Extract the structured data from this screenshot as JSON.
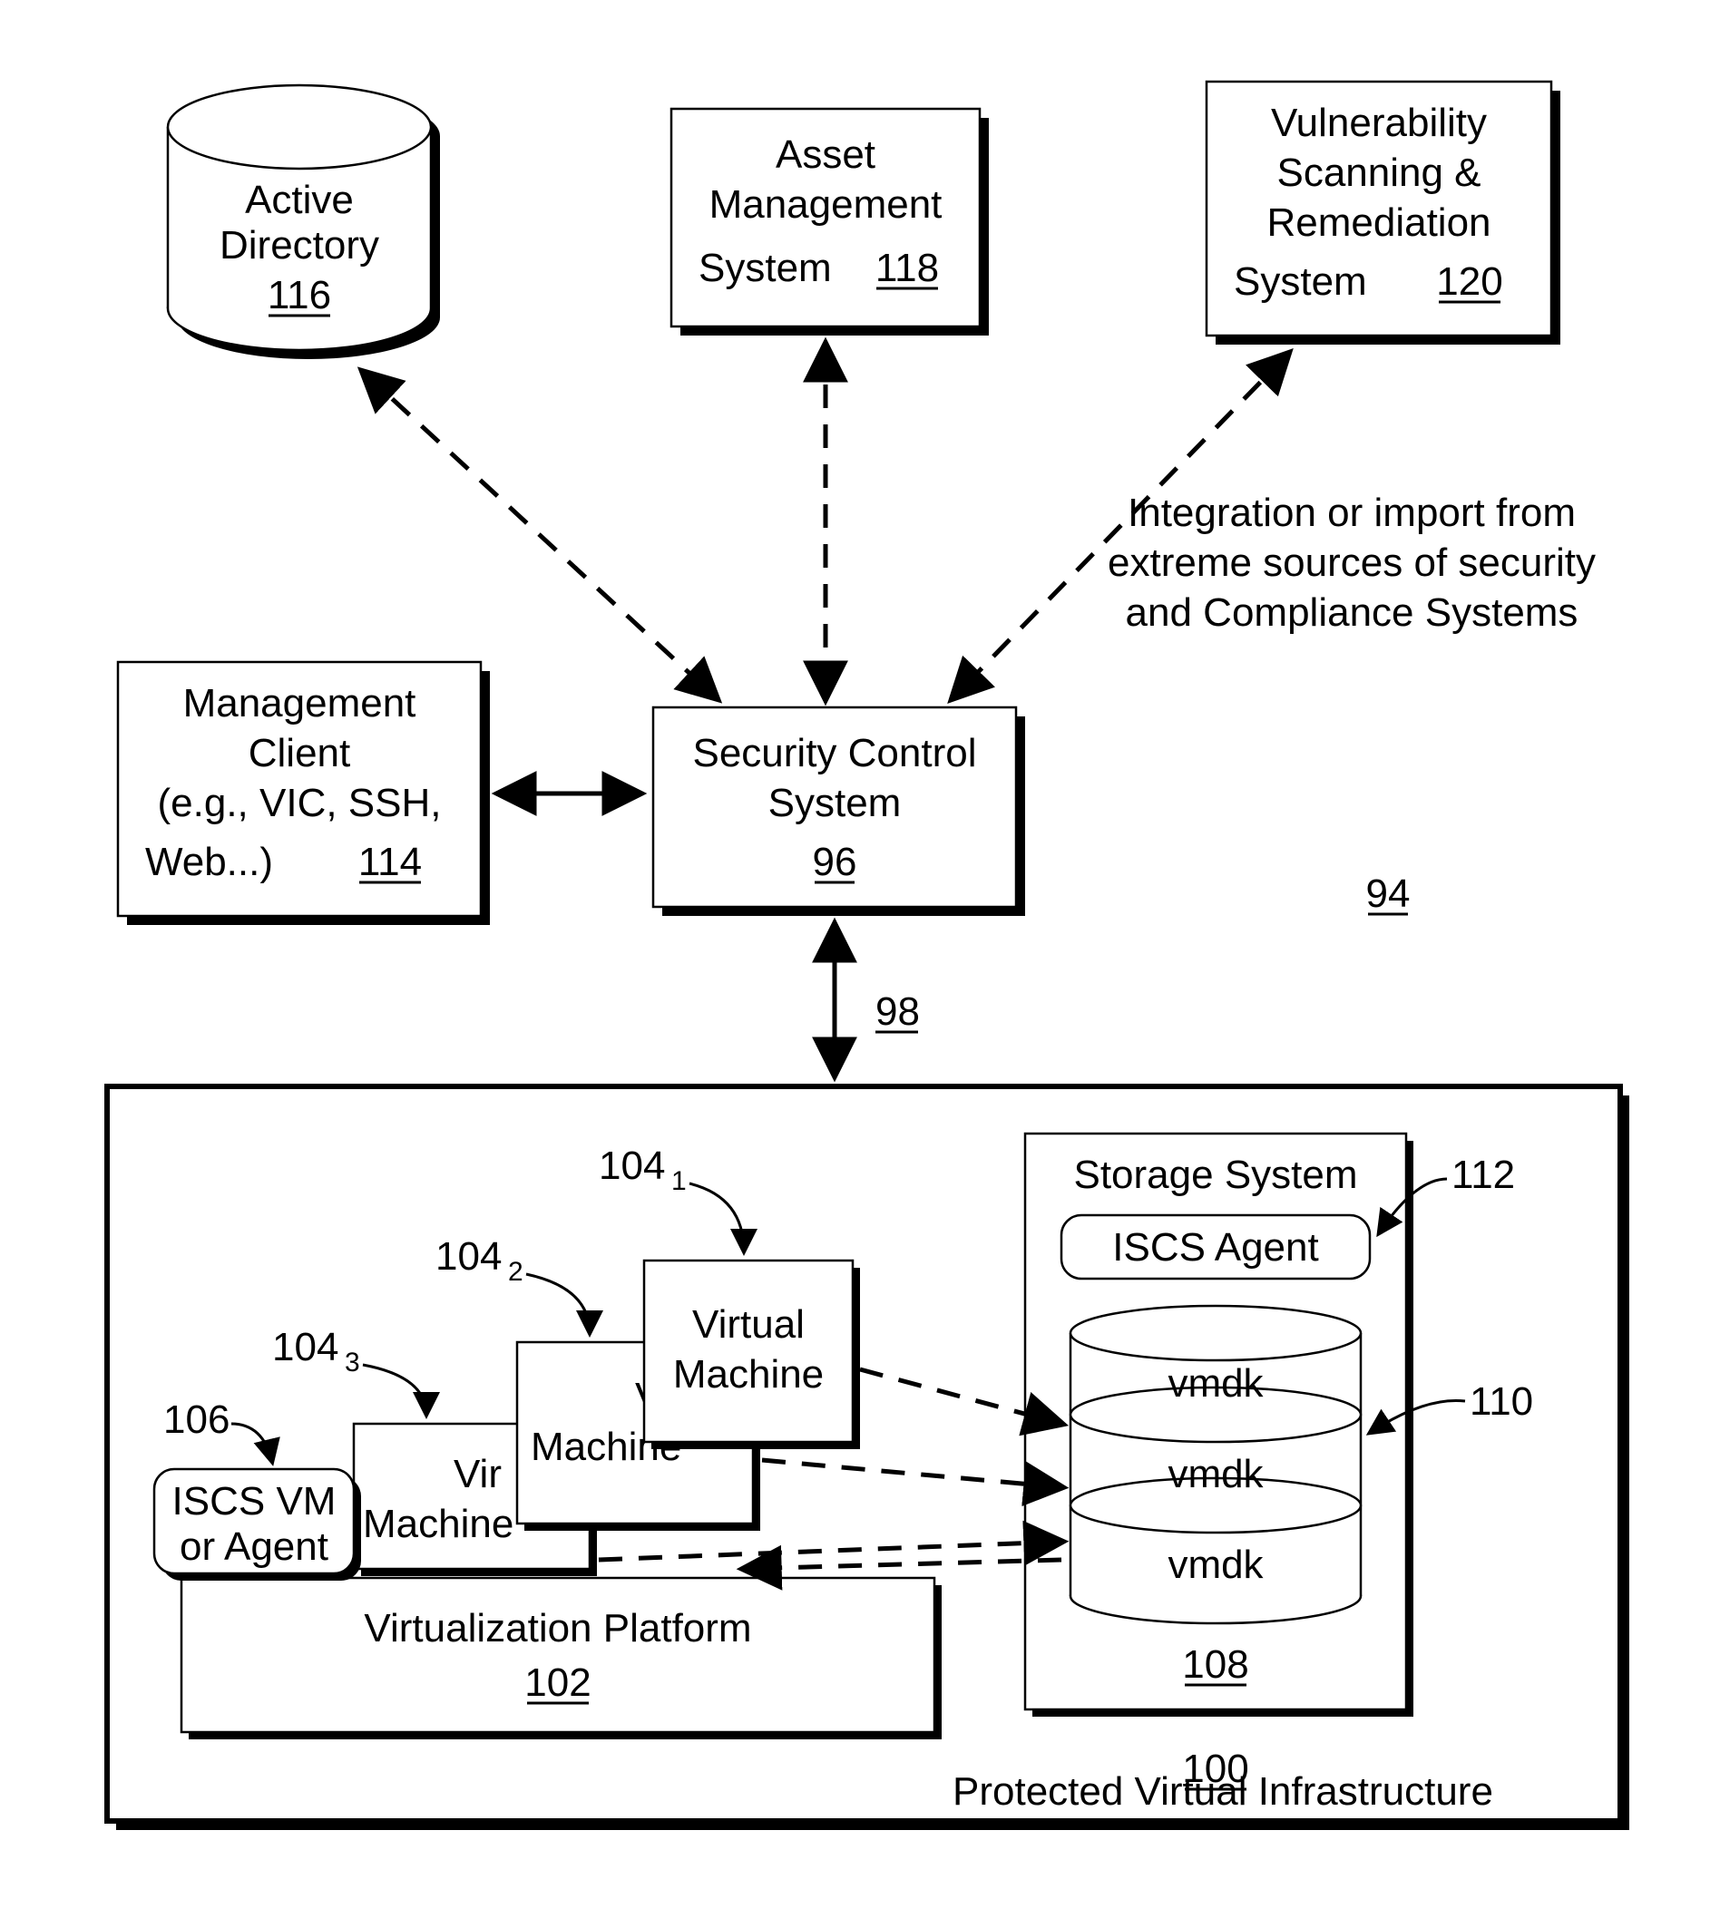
{
  "blocks": {
    "active_directory": {
      "label1": "Active",
      "label2": "Directory",
      "ref": "116"
    },
    "asset_mgmt": {
      "label1": "Asset",
      "label2": "Management",
      "label3": "System",
      "ref": "118"
    },
    "vuln": {
      "label1": "Vulnerability",
      "label2": "Scanning &",
      "label3": "Remediation",
      "label4": "System",
      "ref": "120"
    },
    "mgmt_client": {
      "label1": "Management",
      "label2": "Client",
      "label3": "(e.g., VIC, SSH,",
      "label4": "Web...)",
      "ref": "114"
    },
    "scs": {
      "label1": "Security Control",
      "label2": "System",
      "ref": "96"
    },
    "integration_note": {
      "l1": "Integration or import from",
      "l2": "extreme sources of security",
      "l3": "and Compliance Systems"
    },
    "outer_ref": "94",
    "link_ref": "98",
    "pvi_label": "Protected Virtual Infrastructure",
    "virt_platform": {
      "label": "Virtualization Platform",
      "ref": "102"
    },
    "vm": {
      "label1": "Virtual",
      "label2": "Machine"
    },
    "vm_label_partial_2": {
      "label1": "Virtu",
      "label2": "Machine"
    },
    "vm_label_partial_3": {
      "label1": "Vir",
      "label2": "Machine"
    },
    "vm_refs": {
      "r1": "104",
      "r2": "104",
      "r3": "104",
      "s1": "1",
      "s2": "2",
      "s3": "3"
    },
    "iscs_vm": {
      "label1": "ISCS VM",
      "label2": "or Agent",
      "ref": "106"
    },
    "storage_sys": {
      "label": "Storage System",
      "ref_outer": "100",
      "agent": "ISCS Agent",
      "agent_ref": "112"
    },
    "disk": {
      "slot": "vmdk",
      "ref_stack": "108",
      "ref_side": "110"
    }
  }
}
